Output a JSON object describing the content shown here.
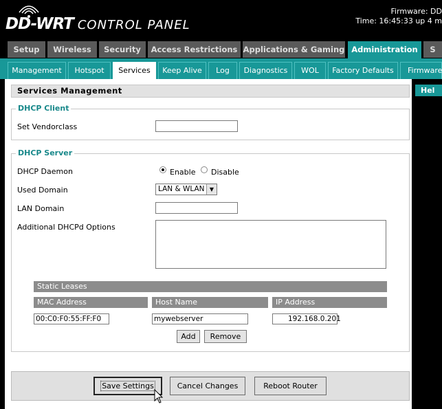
{
  "header": {
    "logo_main": "DD-WRT",
    "logo_sub": "CONTROL PANEL",
    "firmware": "Firmware: DD",
    "time": "Time: 16:45:33 up 4 m"
  },
  "main_tabs": [
    "Setup",
    "Wireless",
    "Security",
    "Access Restrictions",
    "Applications & Gaming",
    "Administration",
    "S"
  ],
  "sub_tabs": [
    "Management",
    "Hotspot",
    "Services",
    "Keep Alive",
    "Log",
    "Diagnostics",
    "WOL",
    "Factory Defaults",
    "Firmware"
  ],
  "help_label": "Hel",
  "section_title": "Services Management",
  "dhcp_client": {
    "legend": "DHCP Client",
    "vendorclass_label": "Set Vendorclass",
    "vendorclass_value": ""
  },
  "dhcp_server": {
    "legend": "DHCP Server",
    "daemon_label": "DHCP Daemon",
    "enable_label": "Enable",
    "disable_label": "Disable",
    "used_domain_label": "Used Domain",
    "used_domain_value": "LAN & WLAN",
    "lan_domain_label": "LAN Domain",
    "lan_domain_value": "",
    "additional_label": "Additional DHCPd Options",
    "static_leases": {
      "title": "Static Leases",
      "col_mac": "MAC Address",
      "col_host": "Host Name",
      "col_ip": "IP Address",
      "mac": "00:C0:F0:55:FF:F0",
      "host": "mywebserver",
      "ip": "192.168.0.201",
      "add_label": "Add",
      "remove_label": "Remove"
    }
  },
  "buttons": {
    "save": "Save Settings",
    "cancel": "Cancel Changes",
    "reboot": "Reboot Router"
  }
}
